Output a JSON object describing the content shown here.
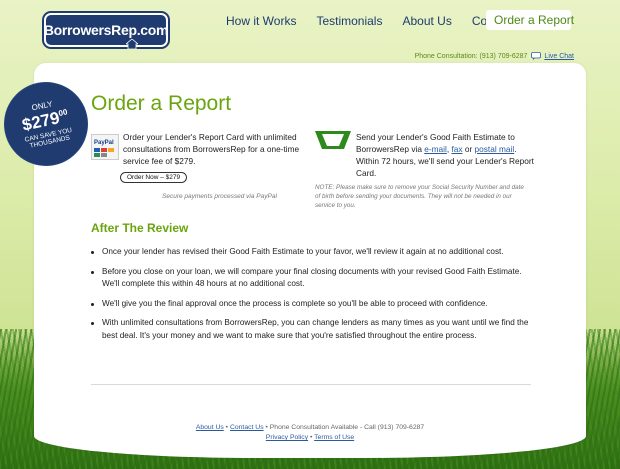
{
  "header": {
    "logo_text": "BorrowersRep.com",
    "nav": [
      "How it Works",
      "Testimonials",
      "About Us",
      "Contact Us"
    ],
    "cta": "Order a Report",
    "consult_text": "Phone Consultation: (913) 709-6287",
    "live_chat": "Live Chat"
  },
  "badge": {
    "line1": "ONLY",
    "currency": "$",
    "amount": "279",
    "cents": "00",
    "line2": "CAN SAVE YOU",
    "line3": "THOUSANDS"
  },
  "main": {
    "title": "Order a Report",
    "col1": {
      "text": "Order your Lender's Report Card with unlimited consultations from BorrowersRep for a one-time service fee of $279.",
      "button": "Order Now – $279",
      "secure": "Secure payments processed via PayPal"
    },
    "col2": {
      "text_a": "Send your Lender's Good Faith Estimate to BorrowersRep via ",
      "link_email": "e-mail",
      "sep1": ", ",
      "link_fax": "fax",
      "sep2": " or ",
      "link_postal": "postal mail",
      "text_b": ". Within 72 hours, we'll send your Lender's Report Card.",
      "note": "NOTE: Please make sure to remove your Social Security Number and date of birth before sending your documents. They will not be needed in our service to you."
    },
    "subhead": "After The Review",
    "bullets": [
      "Once your lender has revised their Good Faith Estimate to your favor, we'll review it again at no additional cost.",
      "Before you close on your loan, we will compare your final closing documents with your revised Good Faith Estimate. We'll complete this within 48 hours at no additional cost.",
      "We'll give you the final approval once the process is complete so you'll be able to proceed with confidence.",
      "With unlimited consultations from BorrowersRep, you can change lenders as many times as you want until we find the best deal. It's your money and we want to make sure that you're satisfied throughout the entire process."
    ]
  },
  "footer": {
    "about": "About Us",
    "sep": " • ",
    "contact": "Contact Us",
    "consult": " • Phone Consultation Available - Call (913) 709-6287",
    "privacy": "Privacy Policy",
    "terms": "Terms of Use"
  },
  "colors": {
    "brand_blue": "#1f3b6f",
    "accent_green": "#6aa50d"
  }
}
